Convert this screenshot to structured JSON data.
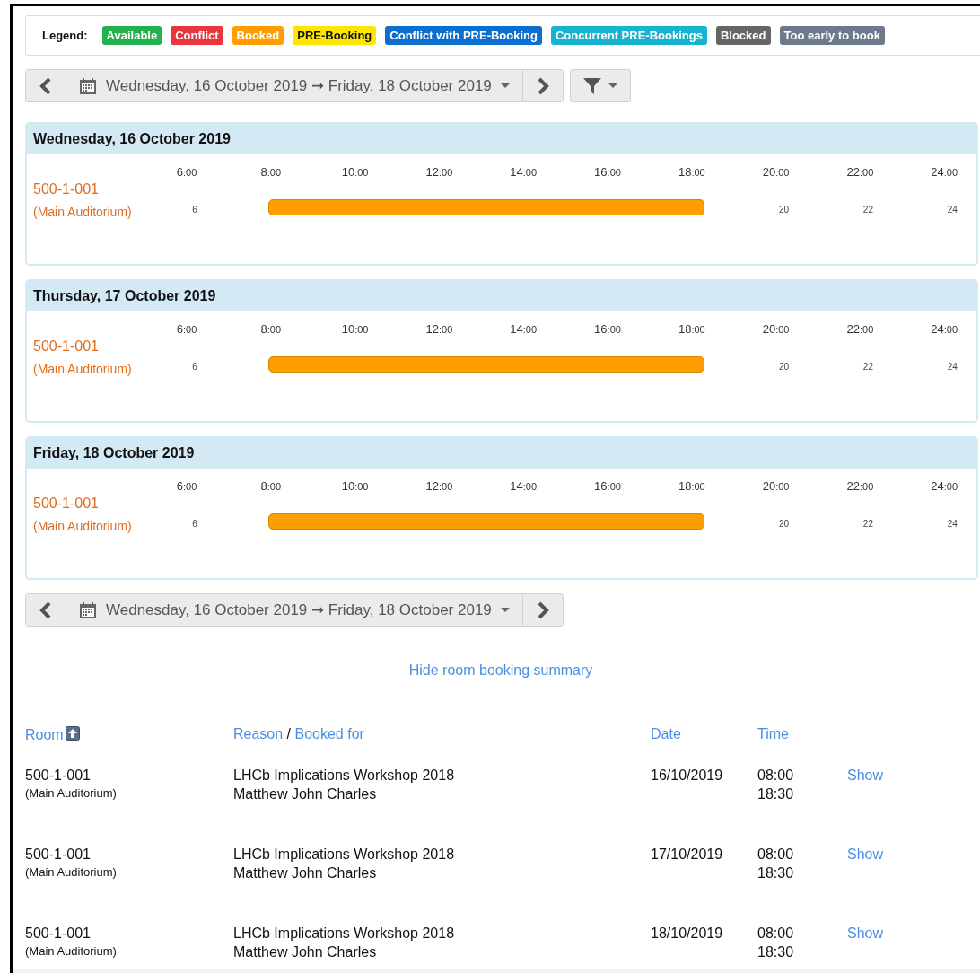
{
  "legend": {
    "label": "Legend:",
    "items": [
      {
        "label": "Available",
        "color": "#22b14c"
      },
      {
        "label": "Conflict",
        "color": "#e8353e"
      },
      {
        "label": "Booked",
        "color": "#ff9e00"
      },
      {
        "label": "PRE-Booking",
        "color": "#ffe600"
      },
      {
        "label": "Conflict with PRE-Booking",
        "color": "#0b6fd0"
      },
      {
        "label": "Concurrent PRE-Bookings",
        "color": "#17b4d0"
      },
      {
        "label": "Blocked",
        "color": "#666666"
      },
      {
        "label": "Too early to book",
        "color": "#6b7b8c"
      }
    ]
  },
  "top_nav": {
    "date_range": "Wednesday, 16 October 2019 ➞ Friday, 18 October 2019",
    "filter": true
  },
  "days": [
    {
      "title": "Wednesday, 16 October 2019",
      "hours": [
        "6:00",
        "8:00",
        "10:00",
        "12:00",
        "14:00",
        "16:00",
        "18:00",
        "20:00",
        "22:00",
        "24:00"
      ],
      "rooms": [
        {
          "name": "500-1-001",
          "detail": "(Main Auditorium)",
          "hour_marks": [
            "6",
            "20",
            "22",
            "24"
          ],
          "bookings": [
            {
              "kind": "booked"
            }
          ]
        }
      ]
    },
    {
      "title": "Thursday, 17 October 2019",
      "hours": [
        "6:00",
        "8:00",
        "10:00",
        "12:00",
        "14:00",
        "16:00",
        "18:00",
        "20:00",
        "22:00",
        "24:00"
      ],
      "rooms": [
        {
          "name": "500-1-001",
          "detail": "(Main Auditorium)",
          "hour_marks": [
            "6",
            "20",
            "22",
            "24"
          ],
          "bookings": [
            {
              "kind": "booked"
            }
          ]
        }
      ]
    },
    {
      "title": "Friday, 18 October 2019",
      "hours": [
        "6:00",
        "8:00",
        "10:00",
        "12:00",
        "14:00",
        "16:00",
        "18:00",
        "20:00",
        "22:00",
        "24:00"
      ],
      "rooms": [
        {
          "name": "500-1-001",
          "detail": "(Main Auditorium)",
          "hour_marks": [
            "6",
            "20",
            "22",
            "24"
          ],
          "bookings": [
            {
              "kind": "booked"
            }
          ]
        }
      ]
    }
  ],
  "bottom_nav": {
    "date_range": "Wednesday, 16 October 2019 ➞ Friday, 18 October 2019"
  },
  "summary_toggle": "Hide room booking summary",
  "summary": {
    "columns": [
      {
        "labels": [
          "Room"
        ],
        "sorted": true
      },
      {
        "labels": [
          "Reason",
          "Booked for"
        ],
        "separator": "/"
      },
      {
        "labels": [
          "Date"
        ]
      },
      {
        "labels": [
          "Time"
        ]
      }
    ],
    "rows": [
      {
        "room": "500-1-001",
        "room_detail": "(Main Auditorium)",
        "reason": "LHCb Implications Workshop 2018",
        "booked_for": "Matthew John Charles",
        "date": "16/10/2019",
        "start": "08:00",
        "end": "18:30",
        "action": "Show"
      },
      {
        "room": "500-1-001",
        "room_detail": "(Main Auditorium)",
        "reason": "LHCb Implications Workshop 2018",
        "booked_for": "Matthew John Charles",
        "date": "17/10/2019",
        "start": "08:00",
        "end": "18:30",
        "action": "Show"
      },
      {
        "room": "500-1-001",
        "room_detail": "(Main Auditorium)",
        "reason": "LHCb Implications Workshop 2018",
        "booked_for": "Matthew John Charles",
        "date": "18/10/2019",
        "start": "08:00",
        "end": "18:30",
        "action": "Show"
      }
    ]
  }
}
